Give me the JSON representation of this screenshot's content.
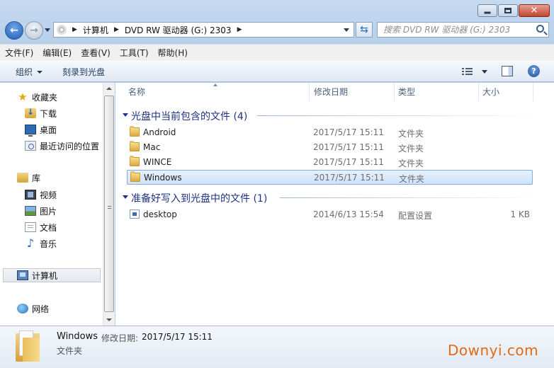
{
  "address": {
    "crumbs": [
      "计算机",
      "DVD RW 驱动器 (G:) 2303"
    ],
    "search_placeholder": "搜索 DVD RW 驱动器 (G:) 2303"
  },
  "menu": [
    "文件(F)",
    "编辑(E)",
    "查看(V)",
    "工具(T)",
    "帮助(H)"
  ],
  "commandbar": {
    "organize": "组织",
    "burn": "刻录到光盘"
  },
  "nav": {
    "favorites": "收藏夹",
    "downloads": "下载",
    "desktop": "桌面",
    "recent": "最近访问的位置",
    "libraries": "库",
    "videos": "视频",
    "pictures": "图片",
    "documents": "文档",
    "music": "音乐",
    "computer": "计算机",
    "network": "网络"
  },
  "columns": {
    "name": "名称",
    "modified": "修改日期",
    "type": "类型",
    "size": "大小"
  },
  "groups": [
    {
      "title": "光盘中当前包含的文件 (4)",
      "items": [
        {
          "name": "Android",
          "modified": "2017/5/17 15:11",
          "type": "文件夹",
          "size": ""
        },
        {
          "name": "Mac",
          "modified": "2017/5/17 15:11",
          "type": "文件夹",
          "size": ""
        },
        {
          "name": "WINCE",
          "modified": "2017/5/17 15:11",
          "type": "文件夹",
          "size": ""
        },
        {
          "name": "Windows",
          "modified": "2017/5/17 15:11",
          "type": "文件夹",
          "size": ""
        }
      ]
    },
    {
      "title": "准备好写入到光盘中的文件 (1)",
      "items": [
        {
          "name": "desktop",
          "modified": "2014/6/13 15:54",
          "type": "配置设置",
          "size": "1 KB"
        }
      ]
    }
  ],
  "details": {
    "name": "Windows",
    "modified_label": "修改日期:",
    "modified": "2017/5/17 15:11",
    "type": "文件夹"
  },
  "watermark": "Downyi.com"
}
